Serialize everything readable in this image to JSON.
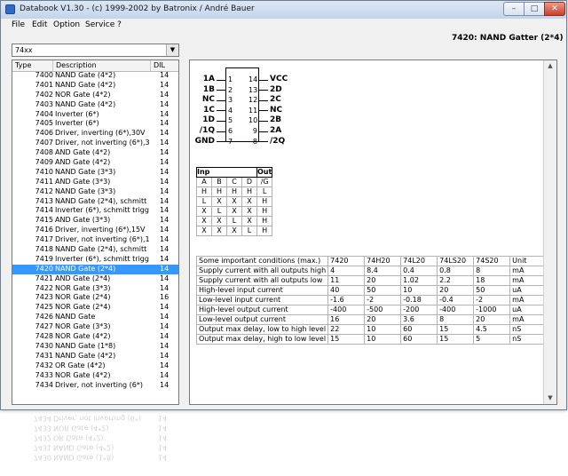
{
  "window": {
    "title": "Databook V1.30  -  (c) 1999-2002 by Batronix / André Bauer"
  },
  "menu": [
    "File",
    "Edit",
    "Option",
    "Service",
    "?"
  ],
  "header": "7420: NAND Gatter (2*4)",
  "family_select": {
    "value": "74xx"
  },
  "list": {
    "columns": [
      "Type",
      "Description",
      "DIL"
    ],
    "selected_index": 20,
    "rows": [
      [
        "7400",
        "NAND Gate (4*2)",
        "14"
      ],
      [
        "7401",
        "NAND Gate (4*2)",
        "14"
      ],
      [
        "7402",
        "NOR Gate (4*2)",
        "14"
      ],
      [
        "7403",
        "NAND Gate (4*2)",
        "14"
      ],
      [
        "7404",
        "Inverter (6*)",
        "14"
      ],
      [
        "7405",
        "Inverter (6*)",
        "14"
      ],
      [
        "7406",
        "Driver, inverting (6*),30V",
        "14"
      ],
      [
        "7407",
        "Driver, not inverting (6*),30V",
        "14"
      ],
      [
        "7408",
        "AND Gate (4*2)",
        "14"
      ],
      [
        "7409",
        "AND Gate (4*2)",
        "14"
      ],
      [
        "7410",
        "NAND Gate (3*3)",
        "14"
      ],
      [
        "7411",
        "AND Gate (3*3)",
        "14"
      ],
      [
        "7412",
        "NAND Gate (3*3)",
        "14"
      ],
      [
        "7413",
        "NAND Gate (2*4), schmitt trigge",
        "14"
      ],
      [
        "7414",
        "Inverter (6*), schmitt trigger",
        "14"
      ],
      [
        "7415",
        "AND Gate (3*3)",
        "14"
      ],
      [
        "7416",
        "Driver, inverting (6*),15V",
        "14"
      ],
      [
        "7417",
        "Driver, not inverting (6*),15V",
        "14"
      ],
      [
        "7418",
        "NAND Gate (2*4), schmitt trigge",
        "14"
      ],
      [
        "7419",
        "Inverter (6*), schmitt trigger",
        "14"
      ],
      [
        "7420",
        "NAND Gate (2*4)",
        "14"
      ],
      [
        "7421",
        "AND Gate (2*4)",
        "14"
      ],
      [
        "7422",
        "NOR Gate (3*3)",
        "14"
      ],
      [
        "7423",
        "NOR Gate (2*4)",
        "16"
      ],
      [
        "7425",
        "NOR Gate (2*4)",
        "14"
      ],
      [
        "7426",
        "NAND Gate",
        "14"
      ],
      [
        "7427",
        "NOR Gate (3*3)",
        "14"
      ],
      [
        "7428",
        "NOR Gate (4*2)",
        "14"
      ],
      [
        "7430",
        "NAND Gate (1*8)",
        "14"
      ],
      [
        "7431",
        "NAND Gate (4*2)",
        "14"
      ],
      [
        "7432",
        "OR Gate (4*2)",
        "14"
      ],
      [
        "7433",
        "NOR Gate (4*2)",
        "14"
      ],
      [
        "7434",
        "Driver, not inverting (6*)",
        "14"
      ]
    ]
  },
  "pinout": {
    "left": [
      [
        "1A",
        "1"
      ],
      [
        "1B",
        "2"
      ],
      [
        "NC",
        "3"
      ],
      [
        "1C",
        "4"
      ],
      [
        "1D",
        "5"
      ],
      [
        "/1Q",
        "6"
      ],
      [
        "GND",
        "7"
      ]
    ],
    "right": [
      [
        "14",
        "VCC"
      ],
      [
        "13",
        "2D"
      ],
      [
        "12",
        "2C"
      ],
      [
        "11",
        "NC"
      ],
      [
        "10",
        "2B"
      ],
      [
        "9",
        "2A"
      ],
      [
        "8",
        "/2Q"
      ]
    ]
  },
  "truth_table": {
    "inp_label": "Inp",
    "out_label": "Out",
    "headers": [
      "A",
      "B",
      "C",
      "D",
      "/G"
    ],
    "rows": [
      [
        "H",
        "H",
        "H",
        "H",
        "L"
      ],
      [
        "L",
        "X",
        "X",
        "X",
        "H"
      ],
      [
        "X",
        "L",
        "X",
        "X",
        "H"
      ],
      [
        "X",
        "X",
        "L",
        "X",
        "H"
      ],
      [
        "X",
        "X",
        "X",
        "L",
        "H"
      ]
    ]
  },
  "specs": {
    "headers": [
      "Some important conditions (max.)",
      "7420",
      "74H20",
      "74L20",
      "74LS20",
      "74S20",
      "Unit"
    ],
    "rows": [
      [
        "Supply current with all outputs high",
        "4",
        "8.4",
        "0.4",
        "0.8",
        "8",
        "mA"
      ],
      [
        "Supply current with all outputs low",
        "11",
        "20",
        "1.02",
        "2.2",
        "18",
        "mA"
      ],
      [
        "High-level input current",
        "40",
        "50",
        "10",
        "20",
        "50",
        "uA"
      ],
      [
        "Low-level input current",
        "-1.6",
        "-2",
        "-0.18",
        "-0.4",
        "-2",
        "mA"
      ],
      [
        "High-level output current",
        "-400",
        "-500",
        "-200",
        "-400",
        "-1000",
        "uA"
      ],
      [
        "Low-level output current",
        "16",
        "20",
        "3.6",
        "8",
        "20",
        "mA"
      ],
      [
        "Output max delay, low to high level",
        "22",
        "10",
        "60",
        "15",
        "4.5",
        "nS"
      ],
      [
        "Output max delay, high to low level",
        "15",
        "10",
        "60",
        "15",
        "5",
        "nS"
      ]
    ]
  }
}
